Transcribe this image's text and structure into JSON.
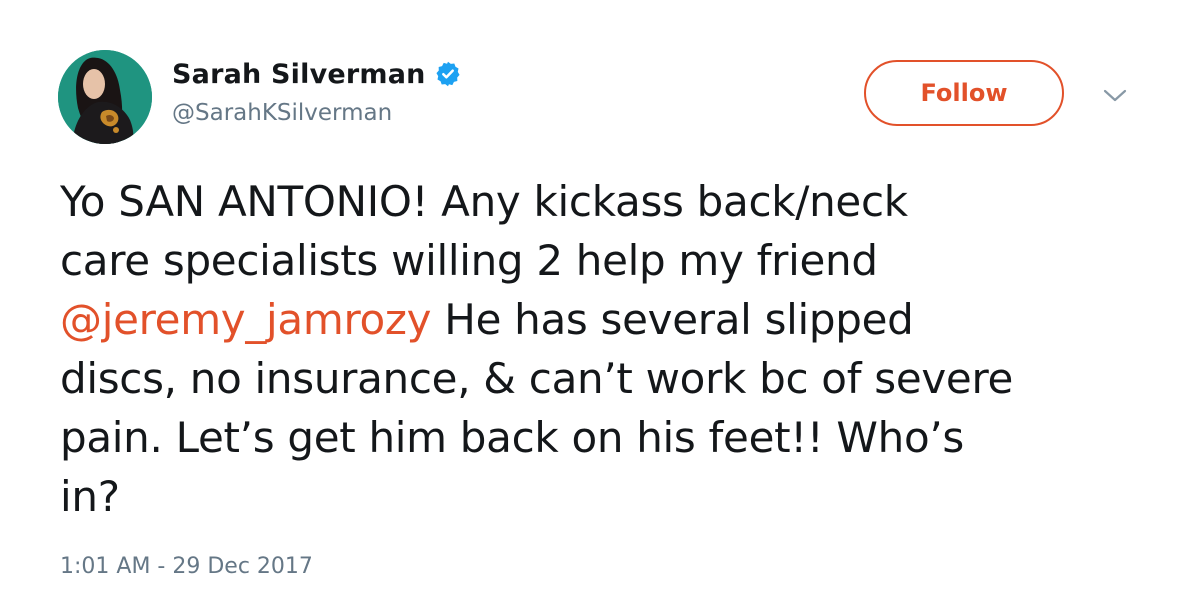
{
  "author": {
    "display_name": "Sarah Silverman",
    "handle": "@SarahKSilverman",
    "verified": true
  },
  "follow_button": {
    "label": "Follow"
  },
  "colors": {
    "accent": "#e2512a",
    "verified_blue": "#1da1f2",
    "muted": "#657786",
    "text": "#14171a"
  },
  "icons": {
    "verified": "verified-badge-icon",
    "menu": "chevron-down-icon"
  },
  "tweet": {
    "lines": [
      {
        "before": "Yo SAN ANTONIO! Any kickass back/neck",
        "mention": "",
        "after": ""
      },
      {
        "before": "care specialists willing 2 help my friend",
        "mention": "",
        "after": ""
      },
      {
        "before": "",
        "mention": "@jeremy_jamrozy",
        "after": " He has several slipped"
      },
      {
        "before": "discs, no insurance, & can’t work bc of severe",
        "mention": "",
        "after": ""
      },
      {
        "before": "pain.  Let’s get him back on his feet!! Who’s",
        "mention": "",
        "after": ""
      },
      {
        "before": "in?",
        "mention": "",
        "after": ""
      }
    ],
    "timestamp": "1:01 AM - 29 Dec 2017"
  }
}
